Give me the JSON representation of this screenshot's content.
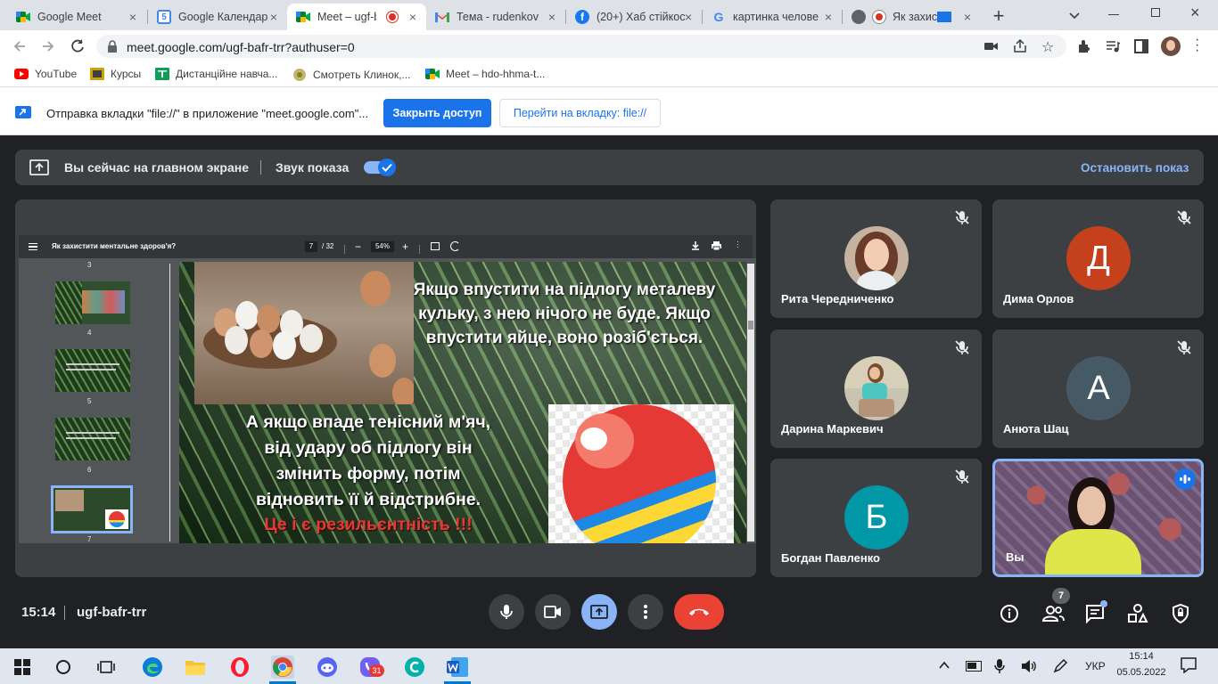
{
  "browser": {
    "tabs": [
      {
        "title": "Google Meet",
        "icon": "meet-icon"
      },
      {
        "title": "Google Календар",
        "icon": "calendar-icon",
        "badge": "5"
      },
      {
        "title": "Meet – ugf-b",
        "icon": "meet-icon",
        "active": true
      },
      {
        "title": "Тема - rudenkov",
        "icon": "gmail-icon"
      },
      {
        "title": "(20+) Хаб стійкос",
        "icon": "facebook-icon"
      },
      {
        "title": "картинка челове",
        "icon": "google-icon"
      },
      {
        "title": "Як захист",
        "icon": "globe-icon"
      }
    ],
    "new_tab": "+",
    "url": "meet.google.com/ugf-bafr-trr?authuser=0",
    "bookmarks": [
      {
        "label": "YouTube",
        "icon": "youtube-icon"
      },
      {
        "label": "Курсы",
        "icon": "folder-icon"
      },
      {
        "label": "Дистанційне навча...",
        "icon": "classroom-icon"
      },
      {
        "label": "Смотреть Клинок,...",
        "icon": "site-icon"
      },
      {
        "label": "Meet – hdo-hhma-t...",
        "icon": "meet-icon"
      }
    ],
    "infobar": {
      "text": "Отправка вкладки \"file://\" в приложение \"meet.google.com\"...",
      "share_button": "Закрыть доступ",
      "switch_button": "Перейти на вкладку: file://"
    }
  },
  "meet": {
    "banner": {
      "presenting": "Вы сейчас на главном экране",
      "sound_label": "Звук показа",
      "stop": "Остановить показ"
    },
    "pdf": {
      "title": "Як захистити ментальне здоров'я?",
      "page_current": "7",
      "page_total": "/ 32",
      "zoom": "54%",
      "thumbs": [
        "3",
        "4",
        "5",
        "6",
        "7"
      ]
    },
    "slide": {
      "text1": "Якщо впустити на підлогу металеву кульку, з нею нічого не буде. Якщо впустити яйце, воно розіб'ється.",
      "text2": "А якщо впаде тенісний м'яч, від удару об підлогу він змінить форму, потім відновить її й відстрибне.",
      "text3": "Це і є резильєнтність !!!"
    },
    "participants": [
      {
        "name": "Рита Чередниченко",
        "type": "photo",
        "muted": true
      },
      {
        "name": "Дима Орлов",
        "initial": "Д",
        "color": "#c5401d",
        "muted": true
      },
      {
        "name": "Дарина Маркевич",
        "type": "photo",
        "muted": true
      },
      {
        "name": "Анюта Шац",
        "initial": "А",
        "color": "#455a64",
        "muted": true
      },
      {
        "name": "Богдан Павленко",
        "initial": "Б",
        "color": "#0097a7",
        "muted": true
      },
      {
        "name": "Вы",
        "type": "video",
        "speaking": true
      }
    ],
    "bottom": {
      "time": "15:14",
      "code": "ugf-bafr-trr",
      "people_count": "7"
    }
  },
  "taskbar": {
    "lang": "УКР",
    "time": "15:14",
    "date": "05.05.2022",
    "viber_badge": "31"
  },
  "colors": {
    "accent": "#1a73e8",
    "meet_bg": "#202124",
    "tile_bg": "#3c4043",
    "end_call": "#ea4335",
    "present_active": "#8ab4f8"
  }
}
